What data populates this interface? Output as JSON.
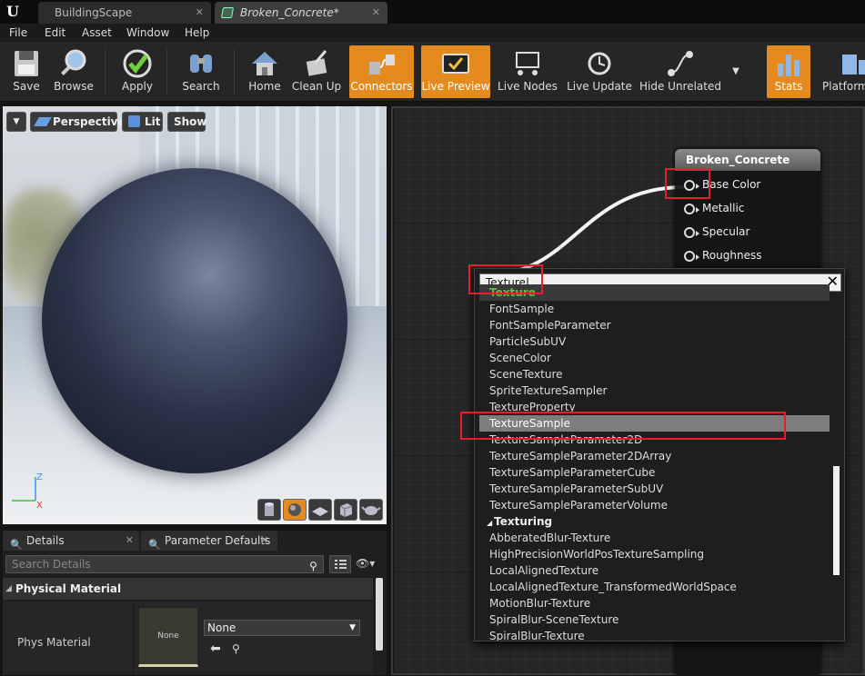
{
  "titlebar": {
    "tabs": [
      {
        "label": "BuildingScape",
        "close": "✕"
      },
      {
        "label": "Broken_Concrete*",
        "close": "✕"
      }
    ]
  },
  "menu": [
    "File",
    "Edit",
    "Asset",
    "Window",
    "Help"
  ],
  "toolbar": {
    "buttons": [
      {
        "label": "Save",
        "icon": "save-icon"
      },
      {
        "label": "Browse",
        "icon": "browse-icon"
      },
      {
        "label": "Apply",
        "icon": "apply-icon"
      },
      {
        "label": "Search",
        "icon": "search-icon"
      },
      {
        "label": "Home",
        "icon": "home-icon"
      },
      {
        "label": "Clean Up",
        "icon": "clean-up-icon"
      },
      {
        "label": "Connectors",
        "icon": "connectors-icon",
        "active": true
      },
      {
        "label": "Live Preview",
        "icon": "live-preview-icon",
        "active": true
      },
      {
        "label": "Live Nodes",
        "icon": "live-nodes-icon"
      },
      {
        "label": "Live Update",
        "icon": "live-update-icon"
      },
      {
        "label": "Hide Unrelated",
        "icon": "hide-unrelated-icon"
      },
      {
        "label": "Stats",
        "icon": "stats-icon",
        "active": true
      },
      {
        "label": "Platform",
        "icon": "platform-icon"
      }
    ]
  },
  "viewport": {
    "menu_arrow": "▼",
    "perspective": "Perspective",
    "lit": "Lit",
    "show": "Show",
    "axis_z": "Z",
    "axis_x": "X",
    "preview_shapes": [
      "cylinder",
      "sphere",
      "plane",
      "cube",
      "custom-mesh"
    ],
    "selected_shape": "sphere"
  },
  "details": {
    "tabs": [
      {
        "label": "Details",
        "close": "✕"
      },
      {
        "label": "Parameter Defaults",
        "close": "✕"
      }
    ],
    "search_placeholder": "Search Details",
    "category": "Physical Material",
    "property_label": "Phys Material",
    "thumbnail_text": "None",
    "asset_value": "None"
  },
  "graph": {
    "material_node": {
      "title": "Broken_Concrete",
      "pins": [
        "Base Color",
        "Metallic",
        "Specular",
        "Roughness"
      ]
    }
  },
  "palette": {
    "search_value": "Texture",
    "clear": "✕",
    "rows": [
      {
        "label": "Texture",
        "kind": "clip"
      },
      {
        "label": "FontSample",
        "kind": "item"
      },
      {
        "label": "FontSampleParameter",
        "kind": "item"
      },
      {
        "label": "ParticleSubUV",
        "kind": "item"
      },
      {
        "label": "SceneColor",
        "kind": "item"
      },
      {
        "label": "SceneTexture",
        "kind": "item"
      },
      {
        "label": "SpriteTextureSampler",
        "kind": "item"
      },
      {
        "label": "TextureProperty",
        "kind": "item"
      },
      {
        "label": "TextureSample",
        "kind": "sel"
      },
      {
        "label": "TextureSampleParameter2D",
        "kind": "item"
      },
      {
        "label": "TextureSampleParameter2DArray",
        "kind": "item"
      },
      {
        "label": "TextureSampleParameterCube",
        "kind": "item"
      },
      {
        "label": "TextureSampleParameterSubUV",
        "kind": "item"
      },
      {
        "label": "TextureSampleParameterVolume",
        "kind": "item"
      },
      {
        "label": "Texturing",
        "kind": "cat"
      },
      {
        "label": "AbberatedBlur-Texture",
        "kind": "item"
      },
      {
        "label": "HighPrecisionWorldPosTextureSampling",
        "kind": "item"
      },
      {
        "label": "LocalAlignedTexture",
        "kind": "item"
      },
      {
        "label": "LocalAlignedTexture_TransformedWorldSpace",
        "kind": "item"
      },
      {
        "label": "MotionBlur-Texture",
        "kind": "item"
      },
      {
        "label": "SpiralBlur-SceneTexture",
        "kind": "item"
      },
      {
        "label": "SpiralBlur-Texture",
        "kind": "item"
      }
    ]
  },
  "colors": {
    "accent": "#e58a1f",
    "highlight": "#e0202a",
    "selection": "#7d7d7d"
  }
}
